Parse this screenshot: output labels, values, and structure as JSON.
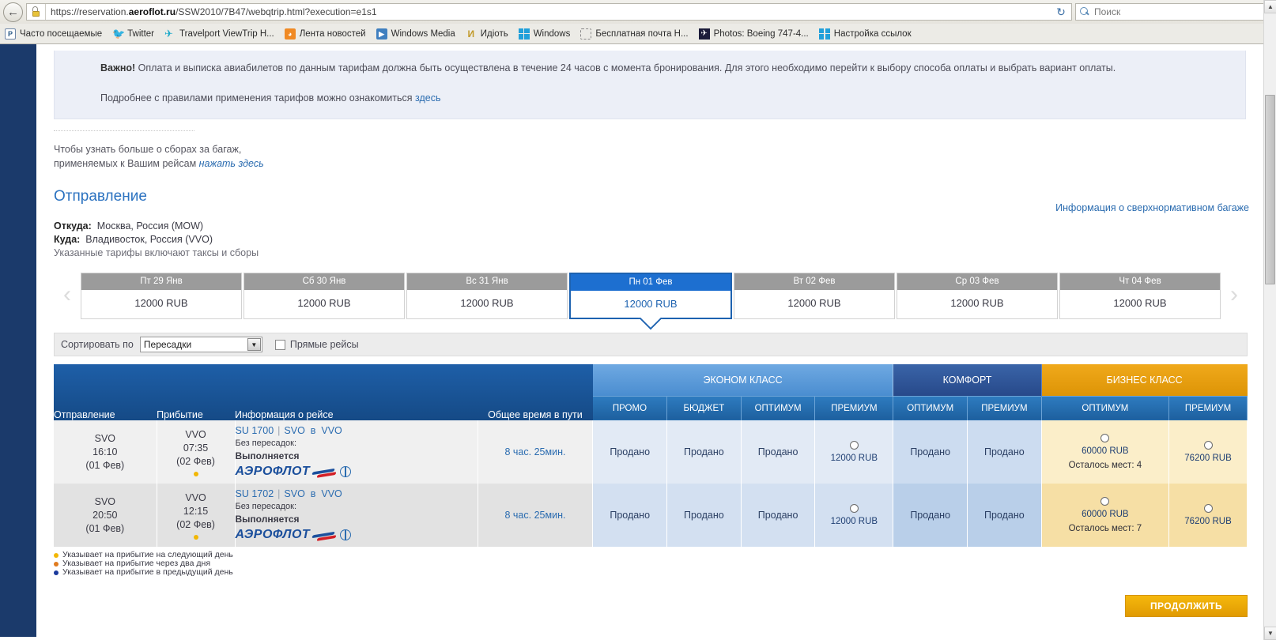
{
  "browser": {
    "url_prefix": "https://reservation.",
    "url_bold": "aeroflot.ru",
    "url_suffix": "/SSW2010/7B47/webqtrip.html?execution=e1s1",
    "search_placeholder": "Поиск",
    "back_glyph": "←",
    "reload_glyph": "↻",
    "bookmarks": [
      {
        "label": "Часто посещаемые",
        "icon": "frequent-icon"
      },
      {
        "label": "Twitter",
        "icon": "twitter-bird-icon"
      },
      {
        "label": "Travelport ViewTrip H...",
        "icon": "travelport-icon"
      },
      {
        "label": "Лента новостей",
        "icon": "rss-icon"
      },
      {
        "label": "Windows Media",
        "icon": "windows-media-icon"
      },
      {
        "label": "Идіоть",
        "icon": "letter-m-icon"
      },
      {
        "label": "Windows",
        "icon": "windows-logo-icon"
      },
      {
        "label": "Бесплатная почта Н...",
        "icon": "dashed-box-icon"
      },
      {
        "label": "Photos: Boeing 747-4...",
        "icon": "airplane-icon"
      },
      {
        "label": "Настройка ссылок",
        "icon": "windows-logo-icon"
      }
    ]
  },
  "notice": {
    "important_label": "Важно!",
    "important_text": " Оплата и выписка авиабилетов по данным тарифам должна быть осуществлена в течение 24 часов с момента бронирования. Для этого необходимо перейти к выбору способа оплаты и выбрать вариант оплаты.",
    "rules_text": "Подробнее с правилами применения тарифов можно ознакомиться ",
    "rules_link": "здесь"
  },
  "baggage": {
    "line1": "Чтобы узнать больше о сборах за багаж,",
    "line2": "применяемых к Вашим рейсам ",
    "link": "нажать здесь",
    "excess_link": "Информация о сверхнормативном багаже"
  },
  "section": {
    "title": "Отправление",
    "from_label": "Откуда:",
    "from_value": "Москва, Россия (MOW)",
    "to_label": "Куда:",
    "to_value": "Владивосток, Россия (VVO)",
    "taxes_note": "Указанные тарифы включают таксы и сборы"
  },
  "date_strip": {
    "prev_glyph": "‹",
    "next_glyph": "›",
    "dates": [
      {
        "day": "Пт 29 Янв",
        "price": "12000 RUB",
        "selected": false
      },
      {
        "day": "Сб 30 Янв",
        "price": "12000 RUB",
        "selected": false
      },
      {
        "day": "Вс 31 Янв",
        "price": "12000 RUB",
        "selected": false
      },
      {
        "day": "Пн 01 Фев",
        "price": "12000 RUB",
        "selected": true
      },
      {
        "day": "Вт 02 Фев",
        "price": "12000 RUB",
        "selected": false
      },
      {
        "day": "Ср 03 Фев",
        "price": "12000 RUB",
        "selected": false
      },
      {
        "day": "Чт 04 Фев",
        "price": "12000 RUB",
        "selected": false
      }
    ]
  },
  "sort_bar": {
    "label": "Сортировать по",
    "selected_option": "Пересадки",
    "options": [
      "Пересадки"
    ],
    "caret_glyph": "▼",
    "direct_label": "Прямые рейсы",
    "direct_checked": false
  },
  "table": {
    "columns": {
      "departure": "Отправление",
      "arrival": "Прибытие",
      "flight_info": "Информация о рейсе",
      "total_time": "Общее время в пути"
    },
    "class_groups": [
      {
        "name": "ЭКОНОМ КЛАСС",
        "color": "#4a8dd0",
        "subcols": [
          "ПРОМО",
          "БЮДЖЕТ",
          "ОПТИМУМ",
          "ПРЕМИУМ"
        ]
      },
      {
        "name": "КОМФОРТ",
        "color": "#27498a",
        "subcols": [
          "ОПТИМУМ",
          "ПРЕМИУМ"
        ]
      },
      {
        "name": "БИЗНЕС КЛАСС",
        "color": "#dd9406",
        "subcols": [
          "ОПТИМУМ",
          "ПРЕМИУМ"
        ]
      }
    ],
    "rows": [
      {
        "dep_airport": "SVO",
        "dep_time": "16:10",
        "dep_date": "(01 Фев)",
        "arr_airport": "VVO",
        "arr_time": "07:35",
        "arr_date": "(02 Фев)",
        "flight_no": "SU 1700",
        "route_from": "SVO",
        "route_via": "в",
        "route_to": "VVO",
        "stops_label": "Без пересадок:",
        "status": "Выполняется",
        "carrier": "АЭРОФЛОТ",
        "duration": "8 час. 25мин.",
        "fares": [
          {
            "type": "sold",
            "text": "Продано"
          },
          {
            "type": "sold",
            "text": "Продано"
          },
          {
            "type": "sold",
            "text": "Продано"
          },
          {
            "type": "price",
            "price": "12000 RUB",
            "seats": ""
          },
          {
            "type": "sold",
            "text": "Продано"
          },
          {
            "type": "sold",
            "text": "Продано"
          },
          {
            "type": "price",
            "price": "60000 RUB",
            "seats": "Осталось мест: 4"
          },
          {
            "type": "price",
            "price": "76200 RUB",
            "seats": ""
          }
        ]
      },
      {
        "dep_airport": "SVO",
        "dep_time": "20:50",
        "dep_date": "(01 Фев)",
        "arr_airport": "VVO",
        "arr_time": "12:15",
        "arr_date": "(02 Фев)",
        "flight_no": "SU 1702",
        "route_from": "SVO",
        "route_via": "в",
        "route_to": "VVO",
        "stops_label": "Без пересадок:",
        "status": "Выполняется",
        "carrier": "АЭРОФЛОТ",
        "duration": "8 час. 25мин.",
        "fares": [
          {
            "type": "sold",
            "text": "Продано"
          },
          {
            "type": "sold",
            "text": "Продано"
          },
          {
            "type": "sold",
            "text": "Продано"
          },
          {
            "type": "price",
            "price": "12000 RUB",
            "seats": ""
          },
          {
            "type": "sold",
            "text": "Продано"
          },
          {
            "type": "sold",
            "text": "Продано"
          },
          {
            "type": "price",
            "price": "60000 RUB",
            "seats": "Осталось мест: 7"
          },
          {
            "type": "price",
            "price": "76200 RUB",
            "seats": ""
          }
        ]
      }
    ]
  },
  "legend": [
    {
      "color": "#f2b705",
      "text": "Указывает на прибытие на следующий день"
    },
    {
      "color": "#e07b1f",
      "text": "Указывает на прибытие через два дня"
    },
    {
      "color": "#1b3a9c",
      "text": "Указывает на прибытие в предыдущий день"
    }
  ],
  "continue_button": "ПРОДОЛЖИТЬ"
}
